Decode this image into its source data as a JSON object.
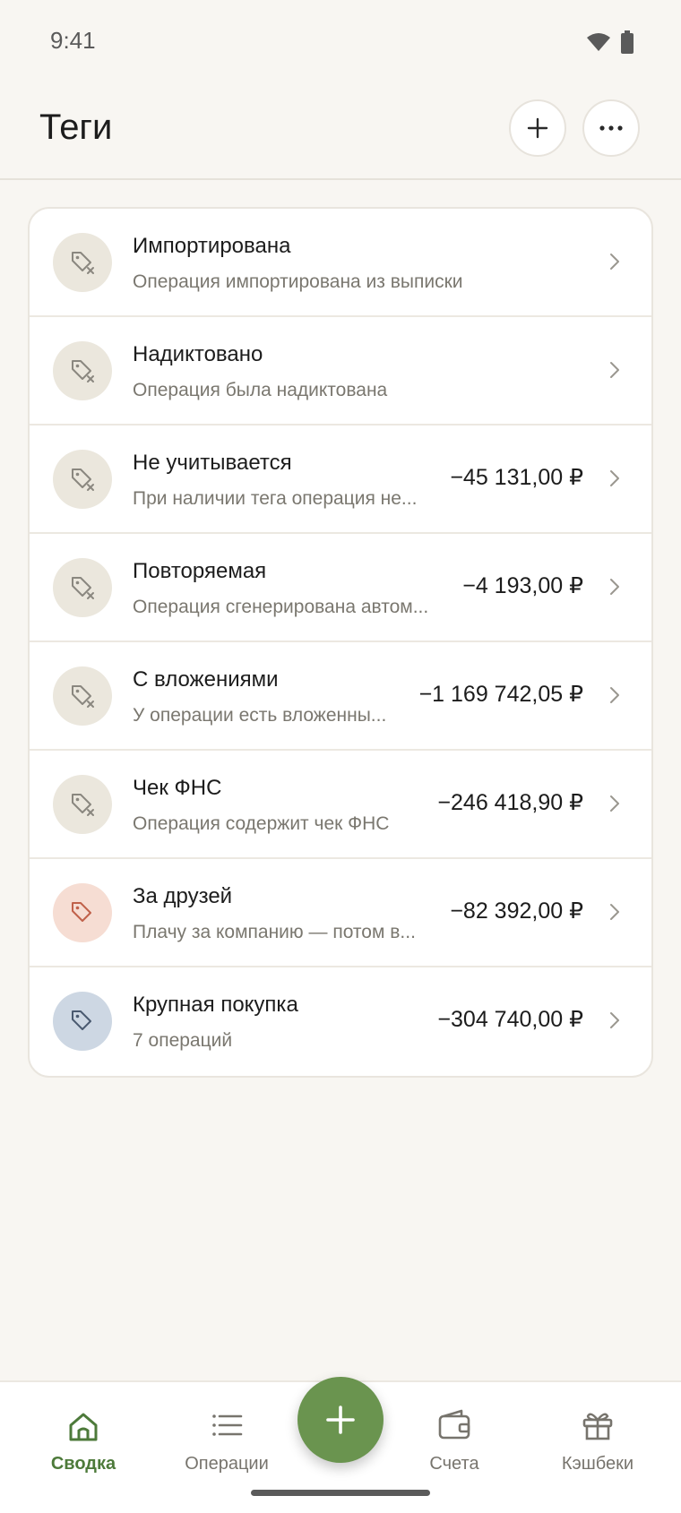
{
  "status_bar": {
    "time": "9:41"
  },
  "header": {
    "title": "Теги"
  },
  "tags": [
    {
      "name": "Импортирована",
      "description": "Операция импортирована из выписки",
      "amount": "",
      "icon": "tag-off-icon",
      "avatar_color": "#ebe7dd",
      "icon_color": "#8a877f"
    },
    {
      "name": "Надиктовано",
      "description": "Операция была надиктована",
      "amount": "",
      "icon": "tag-off-icon",
      "avatar_color": "#ebe7dd",
      "icon_color": "#8a877f"
    },
    {
      "name": "Не учитывается",
      "description": "При наличии тега операция не...",
      "amount": "−45 131,00 ₽",
      "icon": "tag-off-icon",
      "avatar_color": "#ebe7dd",
      "icon_color": "#8a877f"
    },
    {
      "name": "Повторяемая",
      "description": "Операция сгенерирована автом...",
      "amount": "−4 193,00 ₽",
      "icon": "tag-off-icon",
      "avatar_color": "#ebe7dd",
      "icon_color": "#8a877f"
    },
    {
      "name": "С вложениями",
      "description": "У операции есть вложенны...",
      "amount": "−1 169 742,05 ₽",
      "icon": "tag-off-icon",
      "avatar_color": "#ebe7dd",
      "icon_color": "#8a877f"
    },
    {
      "name": "Чек ФНС",
      "description": "Операция содержит чек ФНС",
      "amount": "−246 418,90 ₽",
      "icon": "tag-off-icon",
      "avatar_color": "#ebe7dd",
      "icon_color": "#8a877f"
    },
    {
      "name": "За друзей",
      "description": "Плачу за компанию — потом в...",
      "amount": "−82 392,00 ₽",
      "icon": "tag-icon",
      "avatar_color": "#f6ddd3",
      "icon_color": "#c0614a"
    },
    {
      "name": "Крупная покупка",
      "description": "7 операций",
      "amount": "−304 740,00 ₽",
      "icon": "tag-icon",
      "avatar_color": "#cdd7e3",
      "icon_color": "#4a5a70"
    }
  ],
  "bottom_nav": [
    {
      "label": "Сводка",
      "icon": "home-icon",
      "active": true
    },
    {
      "label": "Операции",
      "icon": "list-icon",
      "active": false
    },
    {
      "label": "Счета",
      "icon": "wallet-icon",
      "active": false
    },
    {
      "label": "Кэшбеки",
      "icon": "gift-icon",
      "active": false
    }
  ],
  "colors": {
    "accent": "#6a944f",
    "active_nav": "#4d7a3a",
    "background": "#f8f6f2"
  }
}
